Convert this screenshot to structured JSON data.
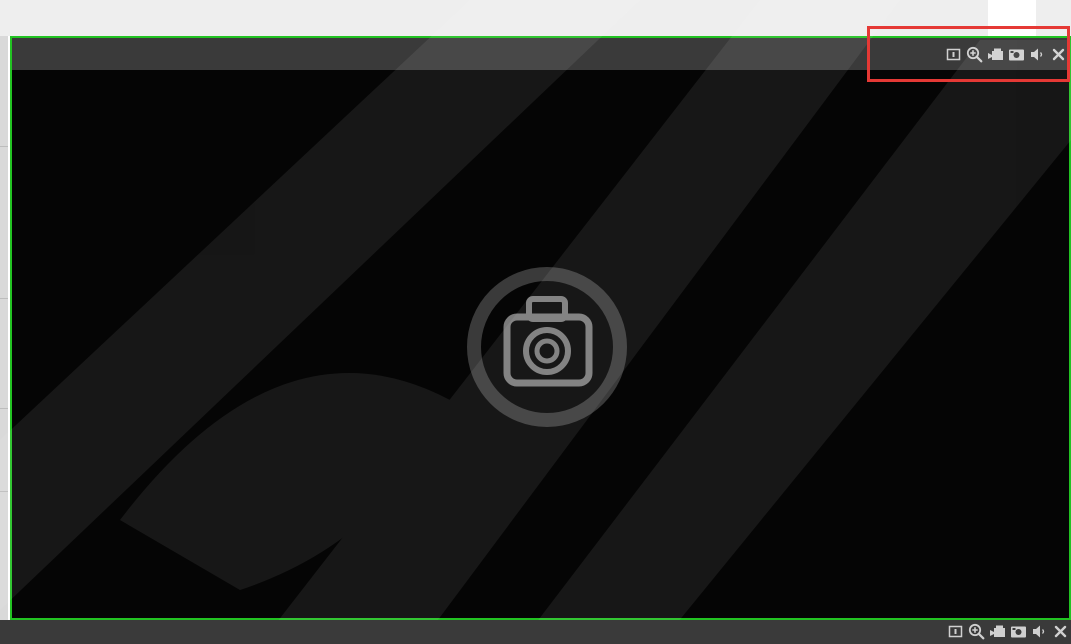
{
  "window": {
    "state": "no-video"
  },
  "toolbar": {
    "items": [
      {
        "icon": "info-icon"
      },
      {
        "icon": "zoom-in-icon"
      },
      {
        "icon": "record-icon"
      },
      {
        "icon": "snapshot-icon"
      },
      {
        "icon": "audio-icon"
      },
      {
        "icon": "close-icon"
      }
    ]
  },
  "colors": {
    "active_border": "#22c322",
    "highlight": "#e53935",
    "titlebar": "#3a3a3a",
    "video_bg": "#050505",
    "icon": "#d0d0d0",
    "placeholder": "#7a7a7a"
  }
}
